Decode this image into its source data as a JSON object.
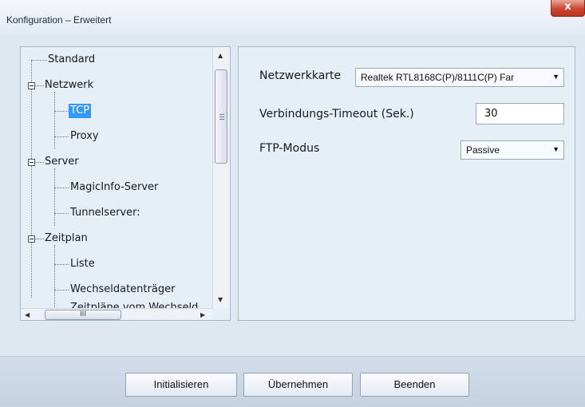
{
  "window": {
    "title": "Konfiguration – Erweitert",
    "close_glyph": "x"
  },
  "tree": {
    "items": [
      {
        "label": "Standard"
      },
      {
        "label": "Netzwerk"
      },
      {
        "label": "TCP",
        "selected": true
      },
      {
        "label": "Proxy"
      },
      {
        "label": "Server"
      },
      {
        "label": "MagicInfo-Server"
      },
      {
        "label": "Tunnelserver:"
      },
      {
        "label": "Zeitplan"
      },
      {
        "label": "Liste"
      },
      {
        "label": "Wechseldatenträger"
      },
      {
        "label": "Zeitpläne vom Wechseld"
      }
    ],
    "scroll_thumb_glyph": "III"
  },
  "settings": {
    "network_card_label": "Netzwerkkarte",
    "network_card_value": "Realtek RTL8168C(P)/8111C(P) Far",
    "timeout_label": "Verbindungs-Timeout (Sek.)",
    "timeout_value": "30",
    "ftp_mode_label": "FTP-Modus",
    "ftp_mode_value": "Passive"
  },
  "buttons": {
    "initialize": "Initialisieren",
    "apply": "Übernehmen",
    "exit": "Beenden"
  },
  "icons": {
    "dropdown": "dropdown-arrow-icon",
    "expander": "tree-collapse-icon"
  }
}
